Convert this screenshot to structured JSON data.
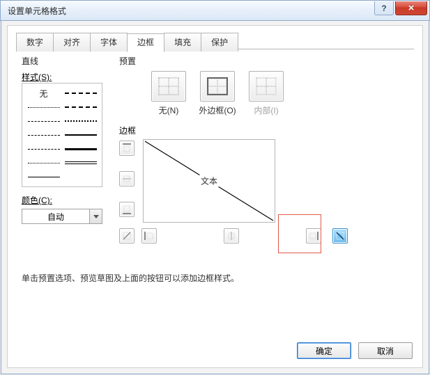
{
  "titlebar": {
    "title": "设置单元格格式",
    "help_glyph": "?",
    "close_glyph": "×"
  },
  "tabs": {
    "items": [
      {
        "label": "数字"
      },
      {
        "label": "对齐"
      },
      {
        "label": "字体"
      },
      {
        "label": "边框"
      },
      {
        "label": "填充"
      },
      {
        "label": "保护"
      }
    ],
    "active_index": 3
  },
  "line_section": {
    "heading": "直线",
    "style_label": "样式(S):",
    "none_label": "无",
    "color_label": "颜色(C):",
    "color_value": "自动"
  },
  "presets_section": {
    "heading": "预置",
    "items": [
      {
        "label": "无(N)"
      },
      {
        "label": "外边框(O)"
      },
      {
        "label": "内部(I)",
        "disabled": true
      }
    ]
  },
  "border_section": {
    "heading": "边框",
    "preview_text": "文本"
  },
  "hint": "单击预置选项、预览草图及上面的按钮可以添加边框样式。",
  "footer": {
    "ok": "确定",
    "cancel": "取消"
  }
}
